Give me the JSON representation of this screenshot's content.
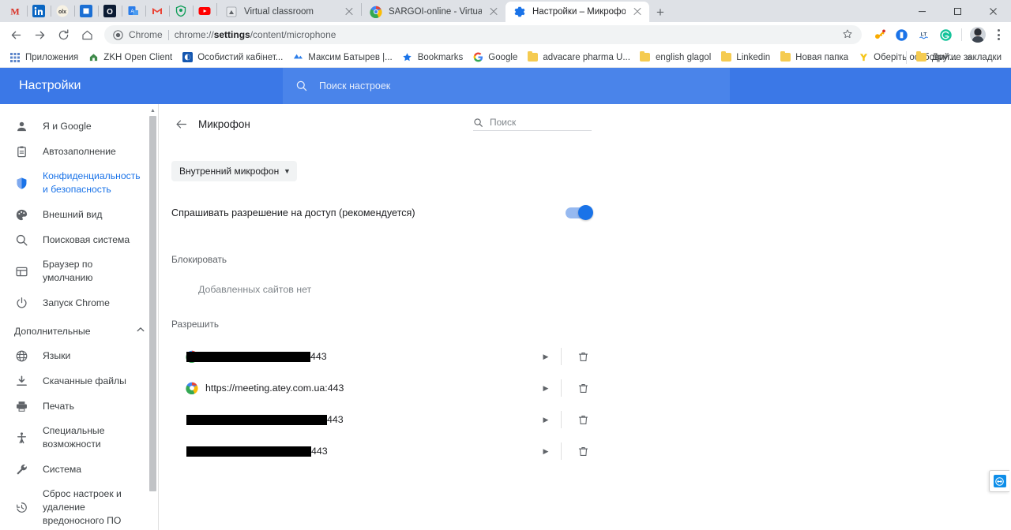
{
  "window": {
    "minimize_label": "Свернуть",
    "maximize_label": "Развернуть",
    "close_label": "Закрыть"
  },
  "tabstrip": {
    "pinned_tabs": [
      {
        "name": "pinned-tab-m",
        "icon": "m-letter-icon",
        "color": "#d93025"
      },
      {
        "name": "pinned-tab-linkedin",
        "icon": "linkedin-icon",
        "color": "#0a66c2"
      },
      {
        "name": "pinned-tab-olx",
        "icon": "olx-icon",
        "color": "#f5f0e6"
      },
      {
        "name": "pinned-tab-blue-square",
        "icon": "blue-square-icon",
        "color": "#1a73e8"
      },
      {
        "name": "pinned-tab-outlook",
        "icon": "o-letter-icon",
        "color": "#0b1b33"
      },
      {
        "name": "pinned-tab-translate",
        "icon": "translate-doc-icon",
        "color": "#2b7de9"
      },
      {
        "name": "pinned-tab-gmail",
        "icon": "gmail-icon",
        "color": "#ea4335"
      },
      {
        "name": "pinned-tab-shield",
        "icon": "green-shield-icon",
        "color": "#0f9d58"
      },
      {
        "name": "pinned-tab-youtube",
        "icon": "youtube-icon",
        "color": "#ff0000"
      }
    ],
    "tabs": [
      {
        "title": "Virtual classroom",
        "favicon": "classroom-icon",
        "active": false
      },
      {
        "title": "SARGOI-online - Virtual classroom",
        "favicon": "chrome-color-icon",
        "active": false
      },
      {
        "title": "Настройки – Микрофон",
        "favicon": "settings-gear-icon",
        "active": true
      }
    ],
    "new_tab_label": "+"
  },
  "toolbar": {
    "back_label": "Назад",
    "forward_label": "Вперёд",
    "reload_label": "Обновить",
    "home_label": "Главная страница",
    "omnibox": {
      "chip_text": "Chrome",
      "url_prefix": "chrome://",
      "url_bold": "settings",
      "url_suffix": "/content/microphone",
      "full_url": "chrome://settings/content/microphone"
    },
    "bookmark_star_label": "Добавить в закладки",
    "extensions": [
      {
        "name": "extension-key-icon",
        "color": "#f9ab00"
      },
      {
        "name": "extension-blue-icon",
        "color": "#1a73e8"
      },
      {
        "name": "extension-languagetool-icon",
        "label": "LT",
        "color": "#2b7de9"
      },
      {
        "name": "extension-grammarly-icon",
        "label": "G",
        "color": "#15c39a"
      }
    ],
    "profile_label": "Профиль",
    "menu_label": "Настройка и управление Google Chrome"
  },
  "bookmarks_bar": {
    "items": [
      {
        "label": "Приложения",
        "icon": "apps-grid-icon"
      },
      {
        "label": "ZKH Open Client",
        "icon": "house-icon"
      },
      {
        "label": "Особистий кабінет...",
        "icon": "blue-circle-icon"
      },
      {
        "label": "Максим Батырев |...",
        "icon": "blue-wave-icon"
      },
      {
        "label": "Bookmarks",
        "icon": "star-icon"
      },
      {
        "label": "Google",
        "icon": "google-g-icon"
      },
      {
        "label": "advacare pharma U...",
        "icon": "folder-icon"
      },
      {
        "label": "english glagol",
        "icon": "folder-icon"
      },
      {
        "label": "Linkedin",
        "icon": "folder-icon"
      },
      {
        "label": "Новая папка",
        "icon": "folder-icon"
      },
      {
        "label": "Оберіть особовий...",
        "icon": "yellow-y-icon"
      }
    ],
    "overflow_label": "»",
    "other_bookmarks": {
      "label": "Другие закладки",
      "icon": "folder-icon"
    }
  },
  "settings": {
    "header": {
      "title": "Настройки",
      "search_placeholder": "Поиск настроек",
      "search_icon": "search-icon"
    },
    "sidebar": {
      "items": [
        {
          "label": "Я и Google",
          "icon": "person-icon",
          "selected": false
        },
        {
          "label": "Автозаполнение",
          "icon": "clipboard-icon",
          "selected": false
        },
        {
          "label": "Конфиденциальность и безопасность",
          "icon": "shield-icon",
          "selected": true
        },
        {
          "label": "Внешний вид",
          "icon": "palette-icon",
          "selected": false
        },
        {
          "label": "Поисковая система",
          "icon": "search-icon",
          "selected": false
        },
        {
          "label": "Браузер по умолчанию",
          "icon": "browser-window-icon",
          "selected": false
        },
        {
          "label": "Запуск Chrome",
          "icon": "power-icon",
          "selected": false
        }
      ],
      "advanced_section": {
        "label": "Дополнительные",
        "expanded_icon": "chevron-up-icon"
      },
      "advanced_items": [
        {
          "label": "Языки",
          "icon": "globe-icon"
        },
        {
          "label": "Скачанные файлы",
          "icon": "download-icon"
        },
        {
          "label": "Печать",
          "icon": "printer-icon"
        },
        {
          "label": "Специальные возможности",
          "icon": "accessibility-icon"
        },
        {
          "label": "Система",
          "icon": "wrench-icon"
        },
        {
          "label": "Сброс настроек и удаление вредоносного ПО",
          "icon": "restore-clock-icon"
        }
      ]
    },
    "content": {
      "back_icon": "arrow-left-icon",
      "title": "Микрофон",
      "search_placeholder": "Поиск",
      "search_icon": "search-icon",
      "device_select": {
        "value": "Внутренний микрофон (Con",
        "caret": "▼"
      },
      "ask_permission": {
        "label": "Спрашивать разрешение на доступ (рекомендуется)",
        "toggle_on": true
      },
      "block_section": {
        "label": "Блокировать",
        "empty_text": "Добавленных сайтов нет"
      },
      "allow_section": {
        "label": "Разрешить",
        "sites": [
          {
            "redacted": true,
            "redaction_width": 157,
            "favicon": "generic-site-icon",
            "favicon_visible": true,
            "port_text": "443",
            "caret": "▶",
            "delete_icon": "trash-icon"
          },
          {
            "redacted": false,
            "favicon": "chrome-color-icon",
            "favicon_visible": true,
            "url": "https://meeting.atey.com.ua:443",
            "caret": "▶",
            "delete_icon": "trash-icon"
          },
          {
            "redacted": true,
            "redaction_width": 178,
            "favicon": "generic-site-icon",
            "favicon_visible": false,
            "port_text": "443",
            "caret": "▶",
            "delete_icon": "trash-icon"
          },
          {
            "redacted": true,
            "redaction_width": 158,
            "favicon": "generic-site-icon",
            "favicon_visible": false,
            "port_text": "443",
            "caret": "▶",
            "delete_icon": "trash-icon"
          }
        ]
      }
    },
    "scrollbar": {
      "up_arrow": "▲"
    }
  },
  "floating_widget": {
    "name": "teamviewer-widget",
    "icon": "arrows-horizontal-icon"
  },
  "colors": {
    "accent_blue": "#1a73e8",
    "header_blue": "#3b78e7",
    "search_blue": "#4a84ea",
    "tabstrip_gray": "#dee1e6",
    "text_primary": "#202124",
    "text_secondary": "#5f6368"
  }
}
